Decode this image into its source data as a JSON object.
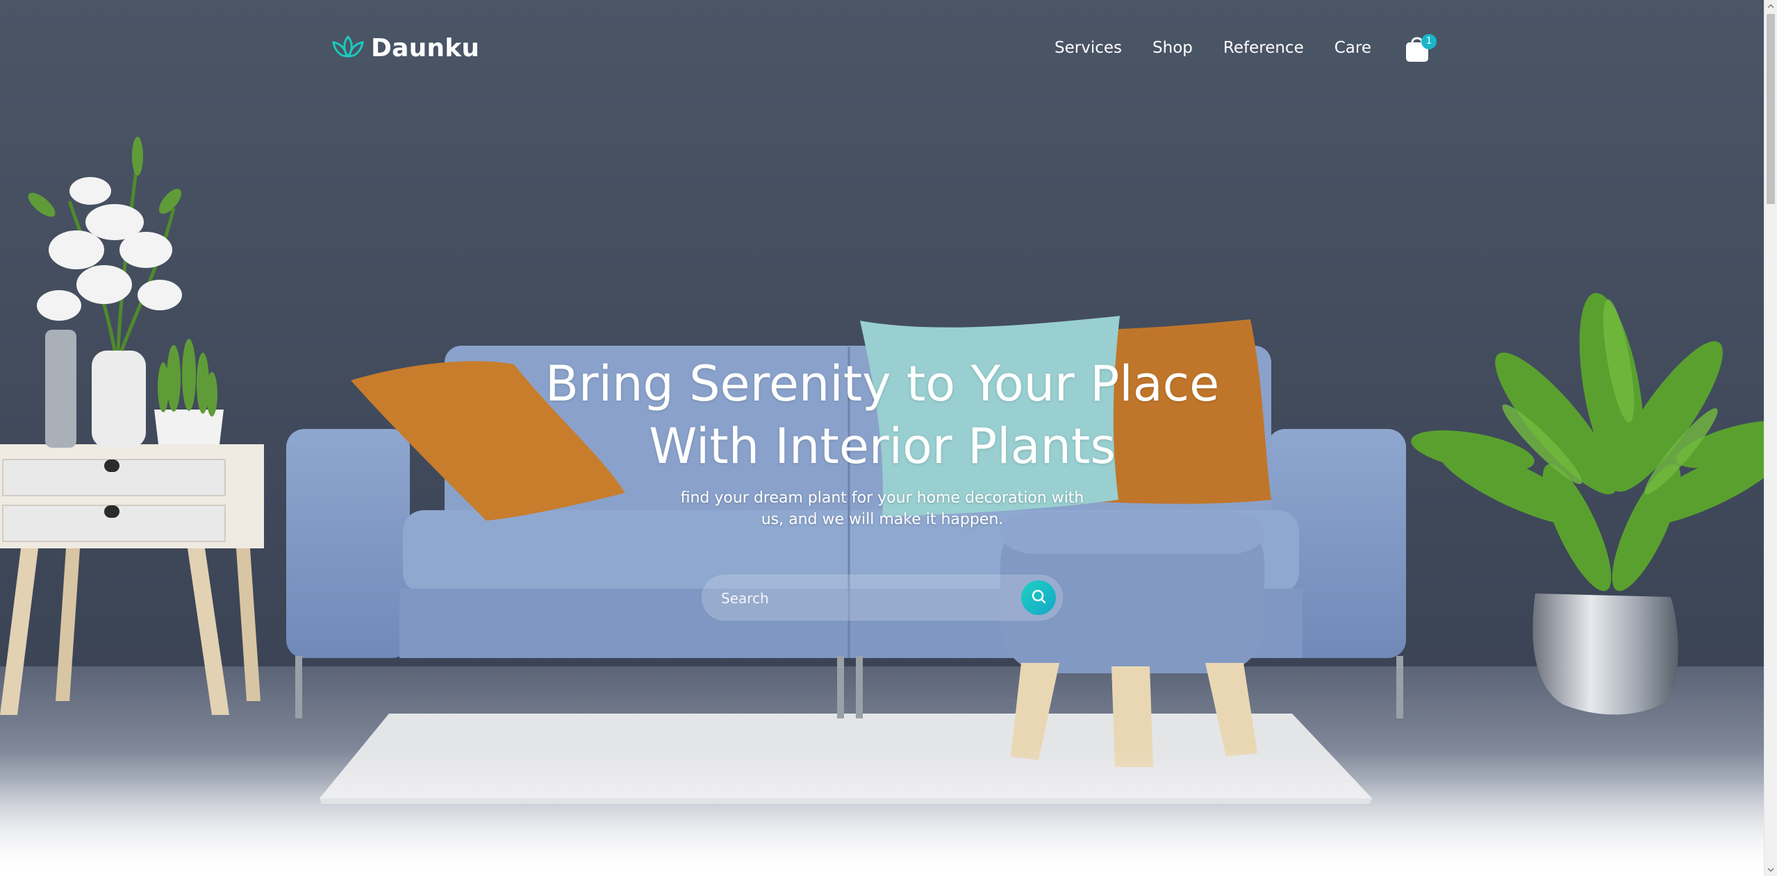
{
  "brand": {
    "name": "Daunku",
    "logo_icon": "lotus-leaf-icon",
    "accent_color": "#1cc8bd"
  },
  "nav": {
    "items": [
      {
        "label": "Services"
      },
      {
        "label": "Shop"
      },
      {
        "label": "Reference"
      },
      {
        "label": "Care"
      }
    ],
    "cart": {
      "icon": "shopping-bag-icon",
      "count": "1",
      "badge_color": "#18b6c8"
    }
  },
  "hero": {
    "title": "Bring Serenity to Your Place With Interior Plants",
    "subtitle": "find your dream plant for your home decoration with us, and we will make it happen.",
    "background": "living-room-photo"
  },
  "search": {
    "placeholder": "Search",
    "value": "",
    "button_icon": "search-icon",
    "button_gradient": [
      "#1fd1c0",
      "#14a7c9"
    ]
  },
  "scrollbar": {
    "up_icon": "chevron-up-icon",
    "down_icon": "chevron-down-icon"
  }
}
